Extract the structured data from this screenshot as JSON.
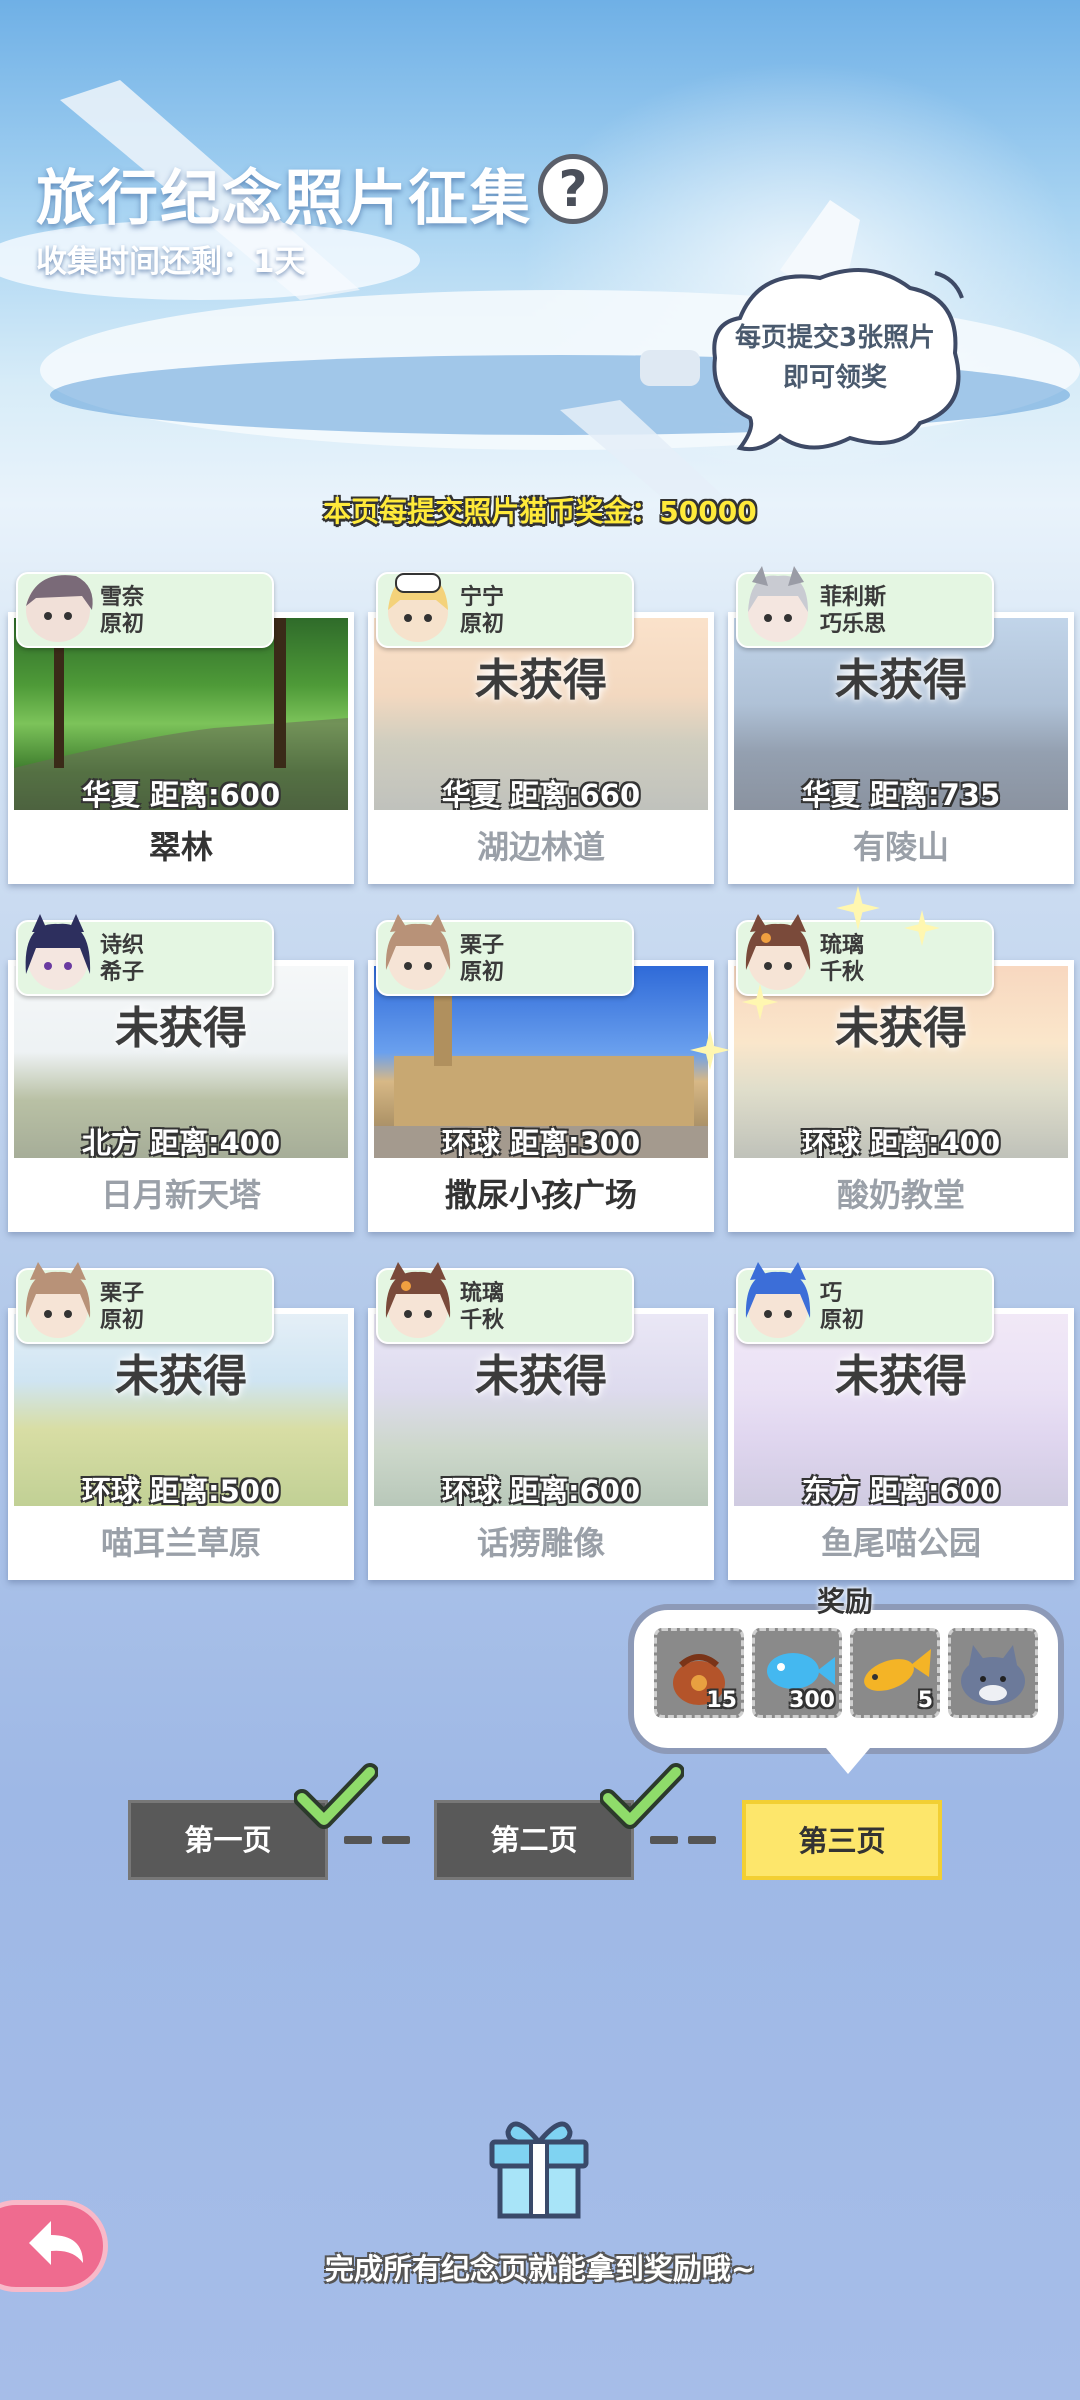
{
  "header": {
    "title": "旅行纪念照片征集",
    "help_icon_text": "?",
    "countdown": "收集时间还剩：1天"
  },
  "hint_bubble": {
    "line1": "每页提交3张照片",
    "line2": "即可领奖"
  },
  "bonus_text": "本页每提交照片猫币奖金：50000",
  "locked_label": "未获得",
  "cards": [
    {
      "char": "雪奈",
      "char2": "原初",
      "region": "华夏",
      "distance": "距离:600",
      "place": "翠林",
      "owned": true
    },
    {
      "char": "宁宁",
      "char2": "原初",
      "region": "华夏",
      "distance": "距离:660",
      "place": "湖边林道",
      "owned": false
    },
    {
      "char": "菲利斯",
      "char2": "巧乐思",
      "region": "华夏",
      "distance": "距离:735",
      "place": "有陵山",
      "owned": false
    },
    {
      "char": "诗织",
      "char2": "希子",
      "region": "北方",
      "distance": "距离:400",
      "place": "日月新天塔",
      "owned": false
    },
    {
      "char": "栗子",
      "char2": "原初",
      "region": "环球",
      "distance": "距离:300",
      "place": "撒尿小孩广场",
      "owned": true
    },
    {
      "char": "琉璃",
      "char2": "千秋",
      "region": "环球",
      "distance": "距离:400",
      "place": "酸奶教堂",
      "owned": false
    },
    {
      "char": "栗子",
      "char2": "原初",
      "region": "环球",
      "distance": "距离:500",
      "place": "喵耳兰草原",
      "owned": false
    },
    {
      "char": "琉璃",
      "char2": "千秋",
      "region": "环球",
      "distance": "距离:600",
      "place": "话痨雕像",
      "owned": false
    },
    {
      "char": "巧",
      "char2": "原初",
      "region": "东方",
      "distance": "距离:600",
      "place": "鱼尾喵公园",
      "owned": false
    }
  ],
  "reward": {
    "title": "奖励",
    "items": [
      {
        "icon": "treasure-bag-icon",
        "count": "15"
      },
      {
        "icon": "blue-fish-icon",
        "count": "300"
      },
      {
        "icon": "golden-fish-icon",
        "count": "5"
      },
      {
        "icon": "cat-plush-icon",
        "count": ""
      }
    ]
  },
  "pages": {
    "p1": "第一页",
    "p2": "第二页",
    "p3": "第三页"
  },
  "footer": {
    "complete_text": "完成所有纪念页就能拿到奖励哦~"
  },
  "colors": {
    "active_page": "#fde66b",
    "tag_bg": "#e4f6e2",
    "bonus_yellow": "#ffea3a",
    "back_pink": "#ef6b8f"
  }
}
